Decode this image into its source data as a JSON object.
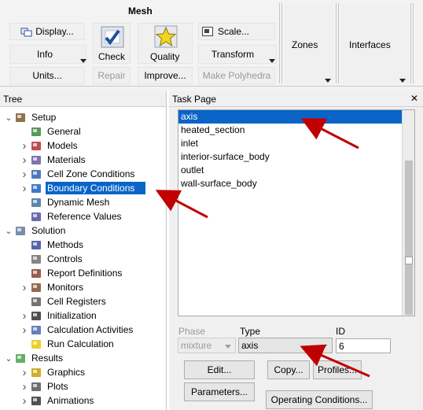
{
  "ribbon": {
    "mesh_group_title": "Mesh",
    "display_label": "Display...",
    "info_label": "Info",
    "units_label": "Units...",
    "check_label": "Check",
    "repair_label": "Repair",
    "quality_label": "Quality",
    "improve_label": "Improve...",
    "scale_label": "Scale...",
    "transform_label": "Transform",
    "make_polyhedra_label": "Make Polyhedra",
    "zones_label": "Zones",
    "interfaces_label": "Interfaces"
  },
  "tree": {
    "header": "Tree",
    "items": [
      {
        "label": "Setup",
        "icon": "setup-icon"
      },
      {
        "label": "General",
        "icon": "general-icon"
      },
      {
        "label": "Models",
        "icon": "models-icon"
      },
      {
        "label": "Materials",
        "icon": "materials-icon"
      },
      {
        "label": "Cell Zone Conditions",
        "icon": "cell-zone-icon"
      },
      {
        "label": "Boundary Conditions",
        "icon": "boundary-conditions-icon"
      },
      {
        "label": "Dynamic Mesh",
        "icon": "dynamic-mesh-icon"
      },
      {
        "label": "Reference Values",
        "icon": "reference-values-icon"
      },
      {
        "label": "Solution",
        "icon": "solution-icon"
      },
      {
        "label": "Methods",
        "icon": "methods-icon"
      },
      {
        "label": "Controls",
        "icon": "controls-icon"
      },
      {
        "label": "Report Definitions",
        "icon": "report-definitions-icon"
      },
      {
        "label": "Monitors",
        "icon": "monitors-icon"
      },
      {
        "label": "Cell Registers",
        "icon": "cell-registers-icon"
      },
      {
        "label": "Initialization",
        "icon": "initialization-icon"
      },
      {
        "label": "Calculation Activities",
        "icon": "calculation-activities-icon"
      },
      {
        "label": "Run Calculation",
        "icon": "run-calculation-icon"
      },
      {
        "label": "Results",
        "icon": "results-icon"
      },
      {
        "label": "Graphics",
        "icon": "graphics-icon"
      },
      {
        "label": "Plots",
        "icon": "plots-icon"
      },
      {
        "label": "Animations",
        "icon": "animations-icon"
      }
    ]
  },
  "task_page": {
    "header": "Task Page",
    "close_glyph": "✕",
    "zones": [
      "axis",
      "heated_section",
      "inlet",
      "interior-surface_body",
      "outlet",
      "wall-surface_body"
    ],
    "phase_label": "Phase",
    "phase_value": "mixture",
    "type_label": "Type",
    "type_value": "axis",
    "id_label": "ID",
    "id_value": "6",
    "edit_label": "Edit...",
    "copy_label": "Copy...",
    "profiles_label": "Profiles...",
    "parameters_label": "Parameters...",
    "operating_conditions_label": "Operating Conditions..."
  },
  "colors": {
    "selection": "#0a64c8",
    "annotation_arrow": "#c00000"
  }
}
